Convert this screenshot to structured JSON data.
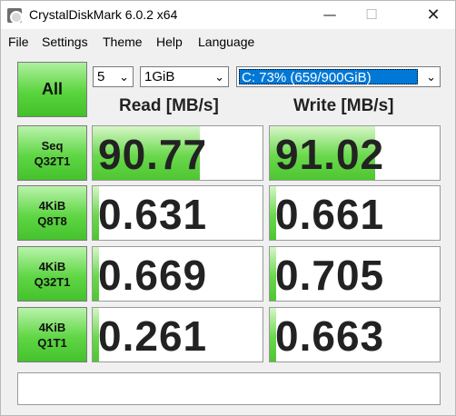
{
  "window": {
    "title": "CrystalDiskMark 6.0.2 x64",
    "minimize": "—",
    "maximize": "☐",
    "close": "✕"
  },
  "menu": [
    "File",
    "Settings",
    "Theme",
    "Help",
    "Language"
  ],
  "controls": {
    "all_label": "All",
    "count": "5",
    "size": "1GiB",
    "drive": "C: 73% (659/900GiB)",
    "arrow": "⌄"
  },
  "headers": {
    "read": "Read [MB/s]",
    "write": "Write [MB/s]"
  },
  "tests": [
    {
      "line1": "Seq",
      "line2": "Q32T1",
      "read": "90.77",
      "write": "91.02",
      "read_fill": 0.63,
      "write_fill": 0.62
    },
    {
      "line1": "4KiB",
      "line2": "Q8T8",
      "read": "0.631",
      "write": "0.661",
      "read_fill": 0.04,
      "write_fill": 0.04
    },
    {
      "line1": "4KiB",
      "line2": "Q32T1",
      "read": "0.669",
      "write": "0.705",
      "read_fill": 0.04,
      "write_fill": 0.04
    },
    {
      "line1": "4KiB",
      "line2": "Q1T1",
      "read": "0.261",
      "write": "0.663",
      "read_fill": 0.04,
      "write_fill": 0.04
    }
  ],
  "comment": ""
}
